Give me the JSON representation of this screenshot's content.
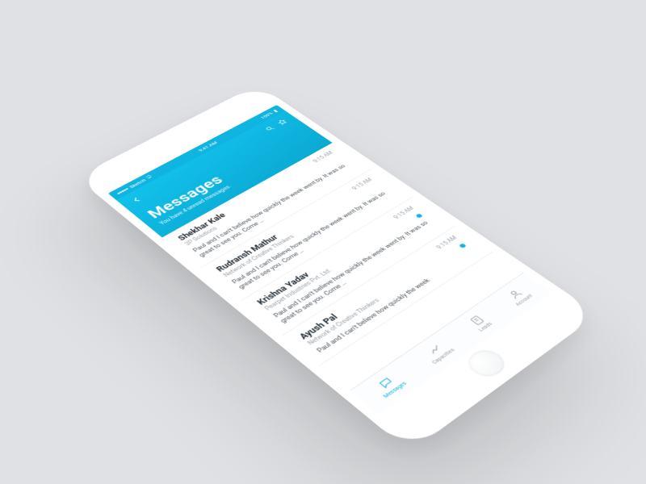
{
  "statusbar": {
    "carrier": "Sketch",
    "time": "9:41 AM",
    "battery": "100%"
  },
  "header": {
    "title": "Messages",
    "subtitle": "You have 4 unread messages."
  },
  "messages": [
    {
      "name": "Shekhar Kale",
      "org": "3P Solutions",
      "preview": "Paul and I can't believe how quickly the week went by. It was so great to see you. Come …",
      "time": "9:15 AM",
      "unread": false
    },
    {
      "name": "Rudransh Mathur",
      "org": "Network of Creative Thinkers",
      "preview": "Paul and I can't believe how quickly the week went by. It was so great to see you. Come …",
      "time": "9:15 AM",
      "unread": false
    },
    {
      "name": "Krishna Yadav",
      "org": "Pearpet Industries Pvt. Ltd.",
      "preview": "Paul and I can't believe how quickly the week went by. It was so great to see you. Come …",
      "time": "9:15 AM",
      "unread": true
    },
    {
      "name": "Ayush Pal",
      "org": "Network of Creative Thinkers",
      "preview": "Paul and I can't believe how quickly the week",
      "time": "9:15 AM",
      "unread": true
    }
  ],
  "tabs": [
    {
      "label": "Messages",
      "active": true
    },
    {
      "label": "Capacities",
      "active": false
    },
    {
      "label": "Leads",
      "active": false
    },
    {
      "label": "Account",
      "active": false
    }
  ]
}
